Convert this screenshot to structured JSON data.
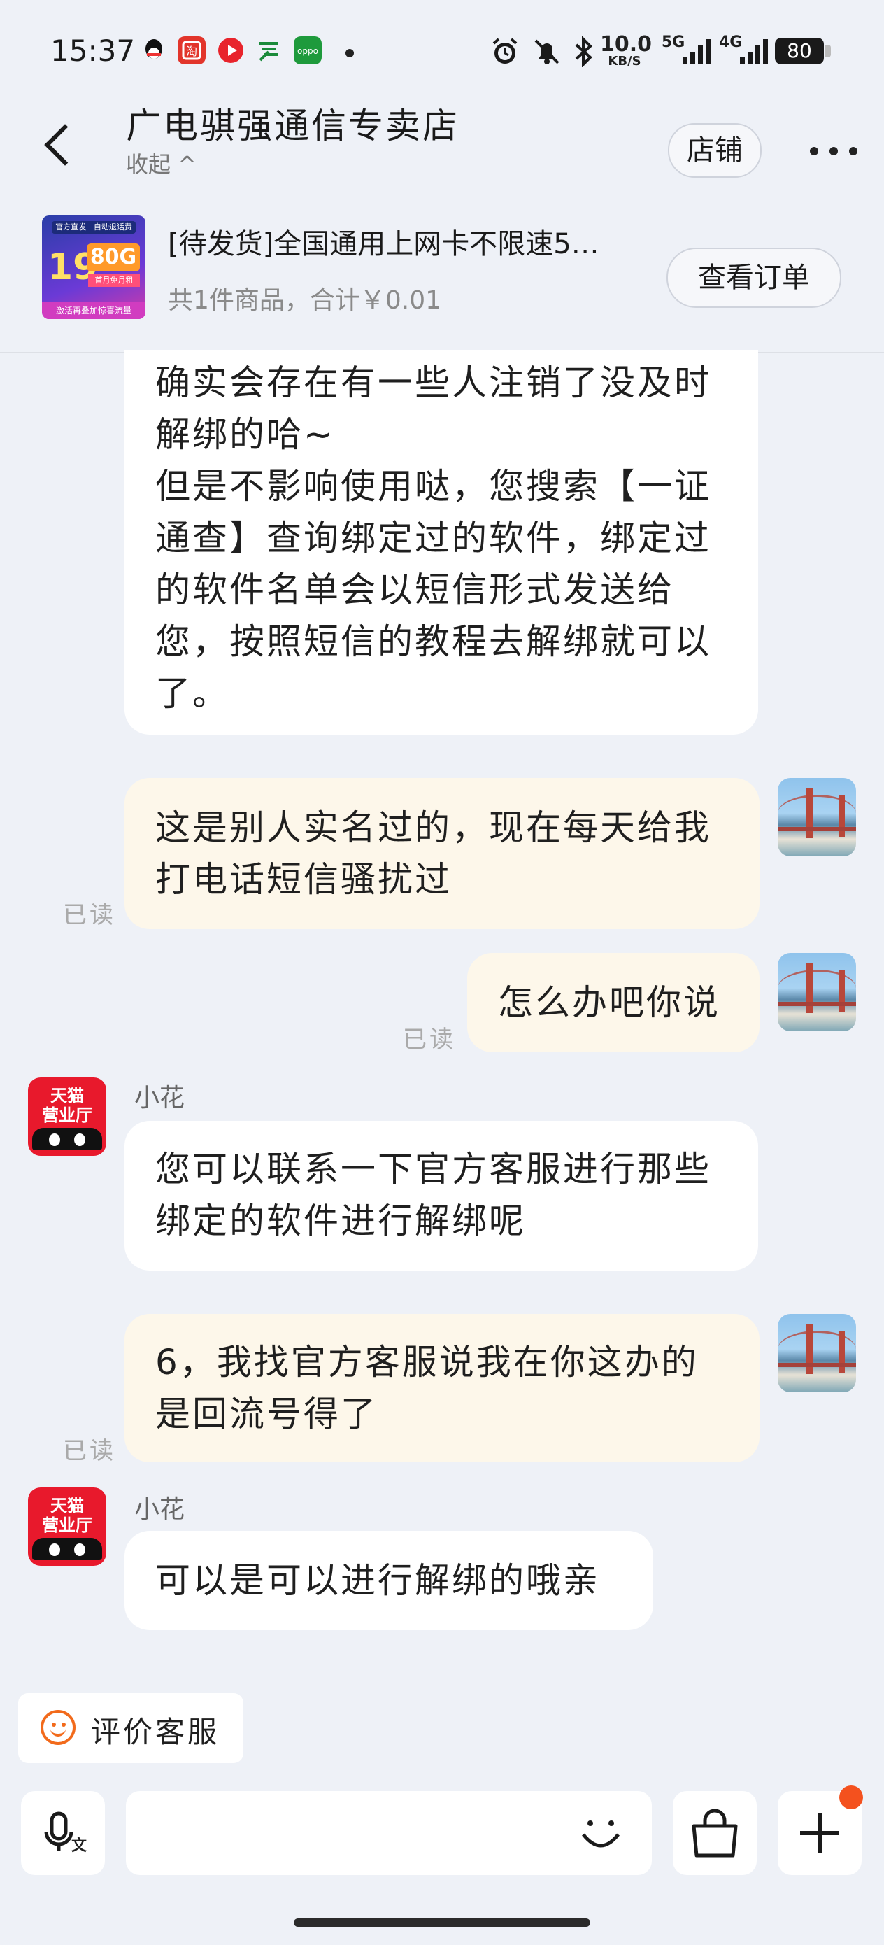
{
  "status_bar": {
    "time": "15:37",
    "net_speed_value": "10.0",
    "net_speed_unit": "KB/S",
    "signal_1": "5G",
    "signal_2": "4G",
    "battery": "80",
    "app_icons": [
      "qq-icon",
      "shop-app-icon",
      "video-app-icon",
      "china-post-icon",
      "oppo-icon"
    ],
    "system_icons": [
      "alarm-icon",
      "mute-icon",
      "bluetooth-icon",
      "signal-icon",
      "battery-icon"
    ]
  },
  "header": {
    "shop_name": "广电骐强通信专卖店",
    "collapse_label": "收起 ^",
    "shop_button": "店铺"
  },
  "order": {
    "title": "[待发货]全国通用上网卡不限速5…",
    "summary": "共1件商品，合计￥0.01",
    "view_button": "查看订单",
    "thumb": {
      "top": "官方直发 | 自动退话费",
      "price": "19",
      "data": "80G",
      "mid": "首月免月租",
      "bottom": "激活再叠加惊喜流量"
    }
  },
  "messages": [
    {
      "side": "left",
      "text": "确实会存在有一些人注销了没及时解绑的哈~\n但是不影响使用哒，您搜索【一证通查】查询绑定过的软件，绑定过的软件名单会以短信形式发送给您，按照短信的教程去解绑就可以了。"
    },
    {
      "side": "right",
      "text": "这是别人实名过的，现在每天给我打电话短信骚扰过",
      "read": "已读"
    },
    {
      "side": "right",
      "text": "怎么办吧你说",
      "read": "已读"
    },
    {
      "side": "left",
      "sender": "小花",
      "text": "您可以联系一下官方客服进行那些绑定的软件进行解绑呢"
    },
    {
      "side": "right",
      "text": "6，我找官方客服说我在你这办的是回流号得了",
      "read": "已读"
    },
    {
      "side": "left",
      "sender": "小花",
      "text": "可以是可以进行解绑的哦亲"
    }
  ],
  "cs_avatar_text": "天猫\n营业厅",
  "rate_button": "评价客服",
  "input_bar": {
    "voice_icon": "voice-to-text-icon",
    "voice_sub": "文",
    "emoji_icon": "emoji-icon",
    "bag_icon": "shopping-bag-icon",
    "plus_icon": "plus-icon"
  },
  "colors": {
    "background": "#eef1f7",
    "cream_bubble": "#fdf7ea",
    "accent_orange": "#f26a1b",
    "tmall_red": "#e8192c"
  }
}
